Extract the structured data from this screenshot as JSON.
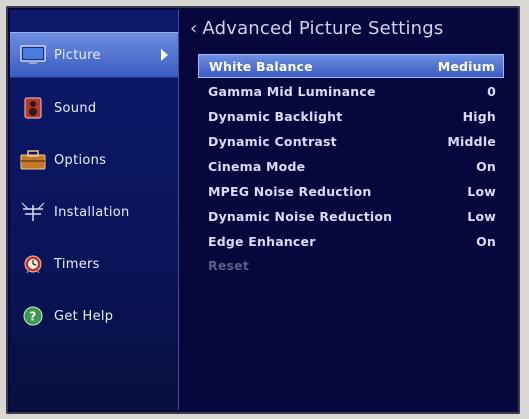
{
  "sidebar": {
    "items": [
      {
        "label": "Picture",
        "icon": "monitor-icon",
        "active": true
      },
      {
        "label": "Sound",
        "icon": "speaker-icon"
      },
      {
        "label": "Options",
        "icon": "toolbox-icon"
      },
      {
        "label": "Installation",
        "icon": "antenna-icon"
      },
      {
        "label": "Timers",
        "icon": "alarm-clock-icon"
      },
      {
        "label": "Get Help",
        "icon": "help-icon"
      }
    ]
  },
  "main": {
    "title": "Advanced Picture Settings",
    "back_glyph": "‹",
    "settings": [
      {
        "label": "White Balance",
        "value": "Medium"
      },
      {
        "label": "Gamma Mid Luminance",
        "value": "0"
      },
      {
        "label": "Dynamic Backlight",
        "value": "High"
      },
      {
        "label": "Dynamic Contrast",
        "value": "Middle"
      },
      {
        "label": "Cinema Mode",
        "value": "On"
      },
      {
        "label": "MPEG Noise Reduction",
        "value": "Low"
      },
      {
        "label": "Dynamic Noise Reduction",
        "value": "Low"
      },
      {
        "label": "Edge Enhancer",
        "value": "On"
      },
      {
        "label": "Reset",
        "value": ""
      }
    ]
  },
  "colors": {
    "background": "#06073c",
    "highlight": "#4e6fd2",
    "text": "#d6dcff",
    "disabled_text": "#5a5f86"
  }
}
